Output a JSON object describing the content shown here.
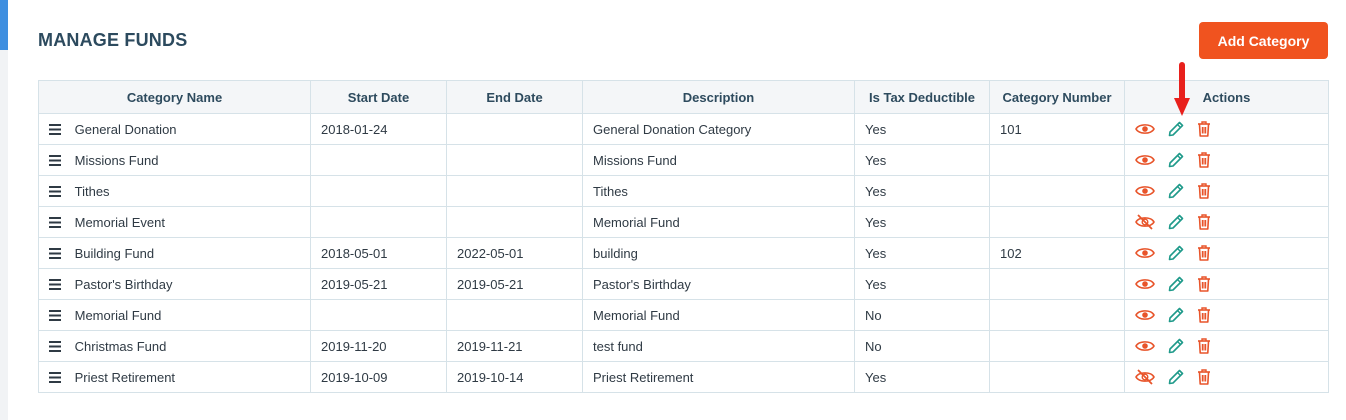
{
  "page": {
    "title": "MANAGE FUNDS"
  },
  "toolbar": {
    "add_label": "Add Category"
  },
  "colors": {
    "brand": "#f0531f",
    "edit": "#1f9a8a",
    "view": "#e8542a",
    "delete": "#e8542a",
    "title": "#2c4a5e",
    "arrow": "#e8201c"
  },
  "icons": {
    "row_handle": "hamburger-icon",
    "view": "eye-icon",
    "hidden": "eye-slash-icon",
    "edit": "pencil-icon",
    "delete": "trash-icon"
  },
  "table": {
    "headers": [
      "Category Name",
      "Start Date",
      "End Date",
      "Description",
      "Is Tax Deductible",
      "Category Number",
      "Actions"
    ],
    "rows": [
      {
        "name": "General Donation",
        "start": "2018-01-24",
        "end": "",
        "description": "General Donation Category",
        "tax": "Yes",
        "number": "101",
        "visible": true
      },
      {
        "name": "Missions Fund",
        "start": "",
        "end": "",
        "description": "Missions Fund",
        "tax": "Yes",
        "number": "",
        "visible": true
      },
      {
        "name": "Tithes",
        "start": "",
        "end": "",
        "description": "Tithes",
        "tax": "Yes",
        "number": "",
        "visible": true
      },
      {
        "name": "Memorial Event",
        "start": "",
        "end": "",
        "description": "Memorial Fund",
        "tax": "Yes",
        "number": "",
        "visible": false
      },
      {
        "name": "Building Fund",
        "start": "2018-05-01",
        "end": "2022-05-01",
        "description": "building",
        "tax": "Yes",
        "number": "102",
        "visible": true
      },
      {
        "name": "Pastor's Birthday",
        "start": "2019-05-21",
        "end": "2019-05-21",
        "description": "Pastor's Birthday",
        "tax": "Yes",
        "number": "",
        "visible": true
      },
      {
        "name": "Memorial Fund",
        "start": "",
        "end": "",
        "description": "Memorial Fund",
        "tax": "No",
        "number": "",
        "visible": true
      },
      {
        "name": "Christmas Fund",
        "start": "2019-11-20",
        "end": "2019-11-21",
        "description": "test fund",
        "tax": "No",
        "number": "",
        "visible": true
      },
      {
        "name": "Priest Retirement",
        "start": "2019-10-09",
        "end": "2019-10-14",
        "description": "Priest Retirement",
        "tax": "Yes",
        "number": "",
        "visible": false
      }
    ]
  }
}
